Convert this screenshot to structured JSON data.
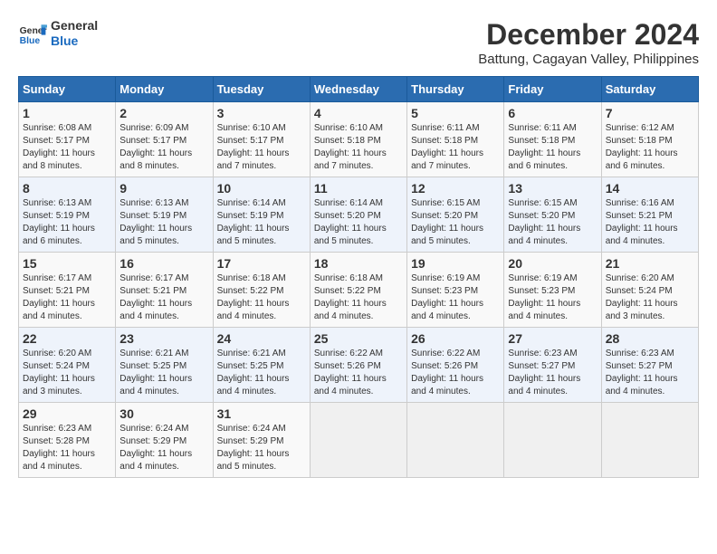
{
  "header": {
    "logo_line1": "General",
    "logo_line2": "Blue",
    "title": "December 2024",
    "subtitle": "Battung, Cagayan Valley, Philippines"
  },
  "days_of_week": [
    "Sunday",
    "Monday",
    "Tuesday",
    "Wednesday",
    "Thursday",
    "Friday",
    "Saturday"
  ],
  "weeks": [
    [
      {
        "day": "1",
        "info": "Sunrise: 6:08 AM\nSunset: 5:17 PM\nDaylight: 11 hours\nand 8 minutes."
      },
      {
        "day": "2",
        "info": "Sunrise: 6:09 AM\nSunset: 5:17 PM\nDaylight: 11 hours\nand 8 minutes."
      },
      {
        "day": "3",
        "info": "Sunrise: 6:10 AM\nSunset: 5:17 PM\nDaylight: 11 hours\nand 7 minutes."
      },
      {
        "day": "4",
        "info": "Sunrise: 6:10 AM\nSunset: 5:18 PM\nDaylight: 11 hours\nand 7 minutes."
      },
      {
        "day": "5",
        "info": "Sunrise: 6:11 AM\nSunset: 5:18 PM\nDaylight: 11 hours\nand 7 minutes."
      },
      {
        "day": "6",
        "info": "Sunrise: 6:11 AM\nSunset: 5:18 PM\nDaylight: 11 hours\nand 6 minutes."
      },
      {
        "day": "7",
        "info": "Sunrise: 6:12 AM\nSunset: 5:18 PM\nDaylight: 11 hours\nand 6 minutes."
      }
    ],
    [
      {
        "day": "8",
        "info": "Sunrise: 6:13 AM\nSunset: 5:19 PM\nDaylight: 11 hours\nand 6 minutes."
      },
      {
        "day": "9",
        "info": "Sunrise: 6:13 AM\nSunset: 5:19 PM\nDaylight: 11 hours\nand 5 minutes."
      },
      {
        "day": "10",
        "info": "Sunrise: 6:14 AM\nSunset: 5:19 PM\nDaylight: 11 hours\nand 5 minutes."
      },
      {
        "day": "11",
        "info": "Sunrise: 6:14 AM\nSunset: 5:20 PM\nDaylight: 11 hours\nand 5 minutes."
      },
      {
        "day": "12",
        "info": "Sunrise: 6:15 AM\nSunset: 5:20 PM\nDaylight: 11 hours\nand 5 minutes."
      },
      {
        "day": "13",
        "info": "Sunrise: 6:15 AM\nSunset: 5:20 PM\nDaylight: 11 hours\nand 4 minutes."
      },
      {
        "day": "14",
        "info": "Sunrise: 6:16 AM\nSunset: 5:21 PM\nDaylight: 11 hours\nand 4 minutes."
      }
    ],
    [
      {
        "day": "15",
        "info": "Sunrise: 6:17 AM\nSunset: 5:21 PM\nDaylight: 11 hours\nand 4 minutes."
      },
      {
        "day": "16",
        "info": "Sunrise: 6:17 AM\nSunset: 5:21 PM\nDaylight: 11 hours\nand 4 minutes."
      },
      {
        "day": "17",
        "info": "Sunrise: 6:18 AM\nSunset: 5:22 PM\nDaylight: 11 hours\nand 4 minutes."
      },
      {
        "day": "18",
        "info": "Sunrise: 6:18 AM\nSunset: 5:22 PM\nDaylight: 11 hours\nand 4 minutes."
      },
      {
        "day": "19",
        "info": "Sunrise: 6:19 AM\nSunset: 5:23 PM\nDaylight: 11 hours\nand 4 minutes."
      },
      {
        "day": "20",
        "info": "Sunrise: 6:19 AM\nSunset: 5:23 PM\nDaylight: 11 hours\nand 4 minutes."
      },
      {
        "day": "21",
        "info": "Sunrise: 6:20 AM\nSunset: 5:24 PM\nDaylight: 11 hours\nand 3 minutes."
      }
    ],
    [
      {
        "day": "22",
        "info": "Sunrise: 6:20 AM\nSunset: 5:24 PM\nDaylight: 11 hours\nand 3 minutes."
      },
      {
        "day": "23",
        "info": "Sunrise: 6:21 AM\nSunset: 5:25 PM\nDaylight: 11 hours\nand 4 minutes."
      },
      {
        "day": "24",
        "info": "Sunrise: 6:21 AM\nSunset: 5:25 PM\nDaylight: 11 hours\nand 4 minutes."
      },
      {
        "day": "25",
        "info": "Sunrise: 6:22 AM\nSunset: 5:26 PM\nDaylight: 11 hours\nand 4 minutes."
      },
      {
        "day": "26",
        "info": "Sunrise: 6:22 AM\nSunset: 5:26 PM\nDaylight: 11 hours\nand 4 minutes."
      },
      {
        "day": "27",
        "info": "Sunrise: 6:23 AM\nSunset: 5:27 PM\nDaylight: 11 hours\nand 4 minutes."
      },
      {
        "day": "28",
        "info": "Sunrise: 6:23 AM\nSunset: 5:27 PM\nDaylight: 11 hours\nand 4 minutes."
      }
    ],
    [
      {
        "day": "29",
        "info": "Sunrise: 6:23 AM\nSunset: 5:28 PM\nDaylight: 11 hours\nand 4 minutes."
      },
      {
        "day": "30",
        "info": "Sunrise: 6:24 AM\nSunset: 5:29 PM\nDaylight: 11 hours\nand 4 minutes."
      },
      {
        "day": "31",
        "info": "Sunrise: 6:24 AM\nSunset: 5:29 PM\nDaylight: 11 hours\nand 5 minutes."
      },
      {
        "day": "",
        "info": ""
      },
      {
        "day": "",
        "info": ""
      },
      {
        "day": "",
        "info": ""
      },
      {
        "day": "",
        "info": ""
      }
    ]
  ]
}
